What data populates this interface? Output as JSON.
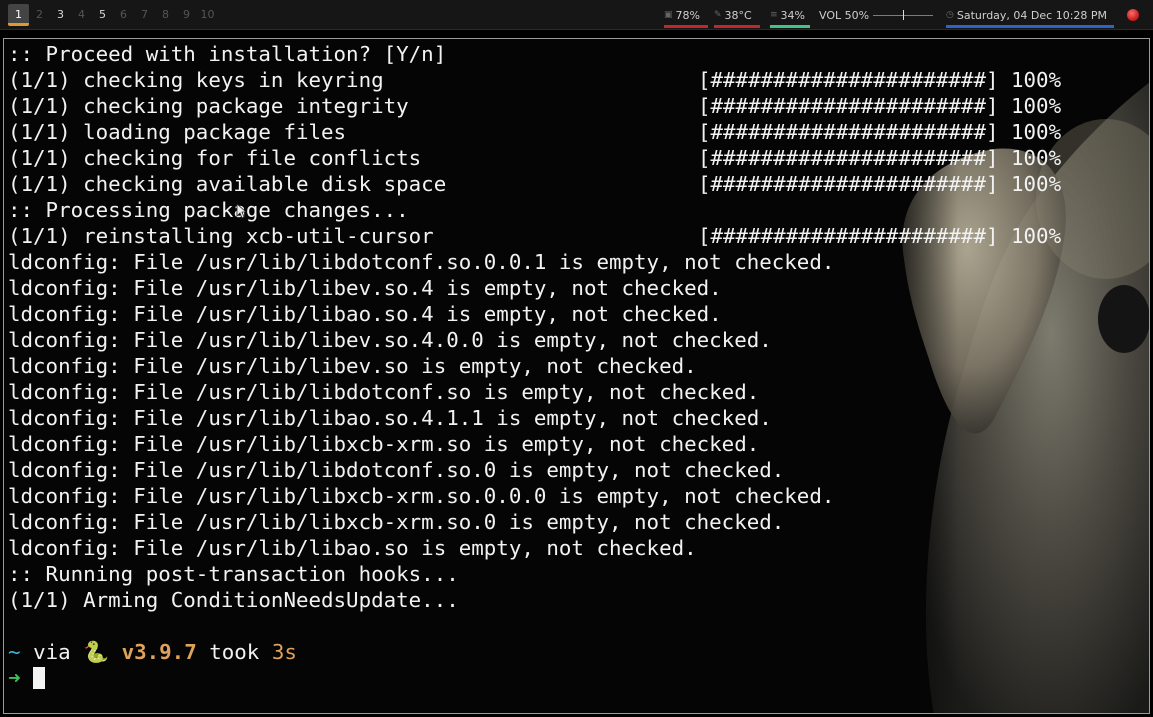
{
  "topbar": {
    "workspaces": [
      {
        "label": "1",
        "state": "active"
      },
      {
        "label": "2",
        "state": "empty"
      },
      {
        "label": "3",
        "state": "occupied"
      },
      {
        "label": "4",
        "state": "empty"
      },
      {
        "label": "5",
        "state": "occupied"
      },
      {
        "label": "6",
        "state": "empty"
      },
      {
        "label": "7",
        "state": "empty"
      },
      {
        "label": "8",
        "state": "empty"
      },
      {
        "label": "9",
        "state": "empty"
      },
      {
        "label": "10",
        "state": "empty"
      }
    ],
    "memory": "78%",
    "temperature": "38°C",
    "cpu": "34%",
    "volume_label": "VOL 50%",
    "volume_level": 0.5,
    "datetime": "Saturday, 04 Dec 10:28 PM",
    "colors": {
      "memory_underline": "#c0282c",
      "temp_underline": "#c0282c",
      "cpu_underline": "#3fc58a",
      "date_underline": "#2e63c9",
      "active_ws_underline": "#e09a2b"
    }
  },
  "terminal": {
    "lines": [
      {
        "text": ":: Proceed with installation? [Y/n]",
        "progress": ""
      },
      {
        "text": "(1/1) checking keys in keyring",
        "progress": "[######################] 100%"
      },
      {
        "text": "(1/1) checking package integrity",
        "progress": "[######################] 100%"
      },
      {
        "text": "(1/1) loading package files",
        "progress": "[######################] 100%"
      },
      {
        "text": "(1/1) checking for file conflicts",
        "progress": "[######################] 100%"
      },
      {
        "text": "(1/1) checking available disk space",
        "progress": "[######################] 100%"
      },
      {
        "text": ":: Processing package changes...",
        "progress": ""
      },
      {
        "text": "(1/1) reinstalling xcb-util-cursor",
        "progress": "[######################] 100%"
      },
      {
        "text": "ldconfig: File /usr/lib/libdotconf.so.0.0.1 is empty, not checked.",
        "progress": ""
      },
      {
        "text": "ldconfig: File /usr/lib/libev.so.4 is empty, not checked.",
        "progress": ""
      },
      {
        "text": "ldconfig: File /usr/lib/libao.so.4 is empty, not checked.",
        "progress": ""
      },
      {
        "text": "ldconfig: File /usr/lib/libev.so.4.0.0 is empty, not checked.",
        "progress": ""
      },
      {
        "text": "ldconfig: File /usr/lib/libev.so is empty, not checked.",
        "progress": ""
      },
      {
        "text": "ldconfig: File /usr/lib/libdotconf.so is empty, not checked.",
        "progress": ""
      },
      {
        "text": "ldconfig: File /usr/lib/libao.so.4.1.1 is empty, not checked.",
        "progress": ""
      },
      {
        "text": "ldconfig: File /usr/lib/libxcb-xrm.so is empty, not checked.",
        "progress": ""
      },
      {
        "text": "ldconfig: File /usr/lib/libdotconf.so.0 is empty, not checked.",
        "progress": ""
      },
      {
        "text": "ldconfig: File /usr/lib/libxcb-xrm.so.0.0.0 is empty, not checked.",
        "progress": ""
      },
      {
        "text": "ldconfig: File /usr/lib/libxcb-xrm.so.0 is empty, not checked.",
        "progress": ""
      },
      {
        "text": "ldconfig: File /usr/lib/libao.so is empty, not checked.",
        "progress": ""
      },
      {
        "text": ":: Running post-transaction hooks...",
        "progress": ""
      },
      {
        "text": "(1/1) Arming ConditionNeedsUpdate...",
        "progress": ""
      },
      {
        "text": "",
        "progress": ""
      }
    ],
    "prompt": {
      "tilde": "~",
      "via": "via",
      "python_icon": "🐍",
      "version": "v3.9.7",
      "took": "took",
      "duration": "3s",
      "arrow": "➜"
    }
  },
  "icons": {
    "memory": "memory-icon",
    "temperature": "thermometer-icon",
    "cpu": "cpu-icon",
    "clock": "clock-icon",
    "power": "power-icon",
    "mouse": "mouse-pointer-icon"
  }
}
